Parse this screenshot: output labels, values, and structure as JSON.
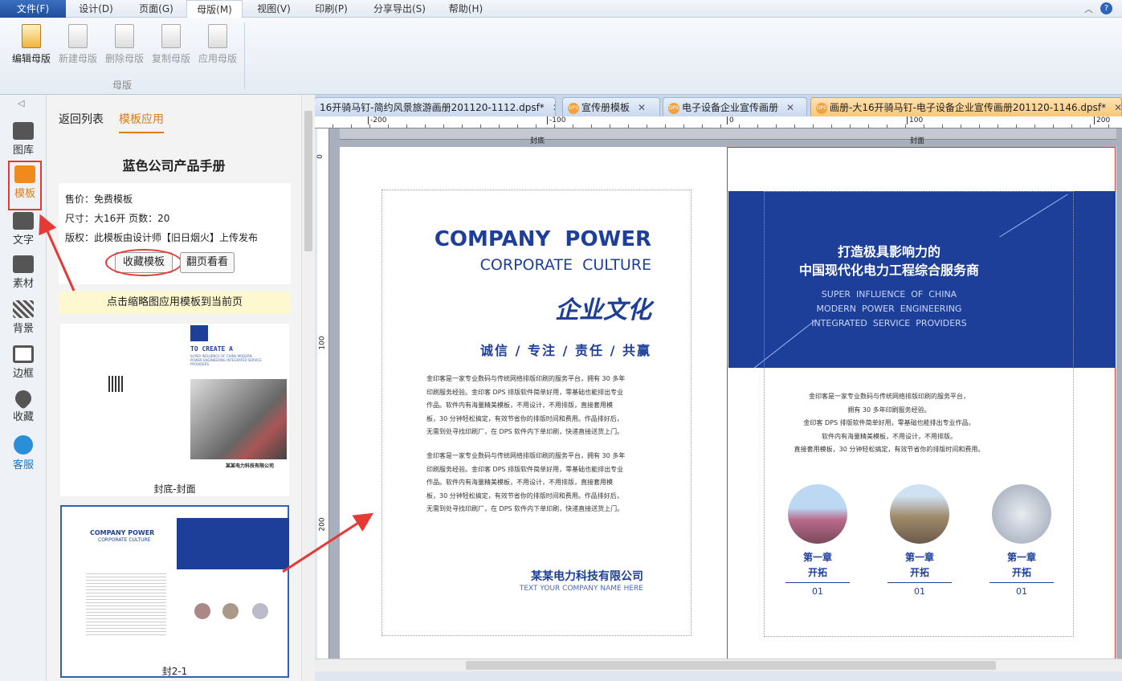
{
  "menu": {
    "items": [
      "文件(F)",
      "设计(D)",
      "页面(G)",
      "母版(M)",
      "视图(V)",
      "印刷(P)",
      "分享导出(S)",
      "帮助(H)"
    ]
  },
  "ribbon": {
    "buttons": [
      "编辑母版",
      "新建母版",
      "删除母版",
      "复制母版",
      "应用母版"
    ],
    "group": "母版"
  },
  "sidebar": {
    "items": [
      "图库",
      "模板",
      "文字",
      "素材",
      "背景",
      "边框",
      "收藏",
      "客服"
    ]
  },
  "panel": {
    "back": "返回列表",
    "tab_active": "模板应用",
    "title": "蓝色公司产品手册",
    "price": "售价：免费模板",
    "size": "尺寸：大16开 页数：20",
    "copyright": "版权：此模板由设计师【旧日烟火】上传发布",
    "fav_button": "收藏模板",
    "flip_button": "翻页看看",
    "hint": "点击缩略图应用模板到当前页",
    "thumbs": [
      {
        "label": "封底-封面",
        "cover_title": "TO CREATE A",
        "cover_sub": "SUPER INFLUENCE OF CHINA MODERN POWER ENGINEERING INTEGRATED SERVICE PROVIDERS",
        "company": "某某电力科技有限公司"
      },
      {
        "label": "封2-1"
      }
    ]
  },
  "tabs": [
    {
      "label": "16开骑马钉-简约风景旅游画册201120-1112.dpsf*"
    },
    {
      "label": "宣传册模板"
    },
    {
      "label": "电子设备企业宣传画册"
    },
    {
      "label": "画册-大16开骑马钉-电子设备企业宣传画册201120-1146.dpsf*",
      "active": true
    }
  ],
  "ruler": {
    "h": [
      "-200",
      "-100",
      "0",
      "100",
      "200"
    ],
    "v": [
      "0",
      "100",
      "200"
    ]
  },
  "pages": {
    "left_label": "封底",
    "right_label": "封面"
  },
  "left_page": {
    "title1": "COMPANY  POWER",
    "title2": "CORPORATE  CULTURE",
    "calligraphy": "企业文化",
    "values": "诚信 / 专注 / 责任 / 共赢",
    "para": [
      "金印客是一家专业数码与传统网络排版印刷的服务平台，拥有 30 多年",
      "印刷服务经验。金印客 DPS 排版软件简单好用，零基础也能排出专业",
      "作品。软件内有海量精美模板，不用设计，不用排版，直接套用模",
      "板，30 分钟轻松搞定，有效节省你的排版时间和费用。作品排好后，",
      "无需到处寻找印刷厂，在 DPS 软件内下单印刷，快递直接送货上门。"
    ],
    "company": "某某电力科技有限公司",
    "company_en": "TEXT YOUR COMPANY NAME HERE"
  },
  "right_page": {
    "head1": "打造极具影响力的",
    "head2": "中国现代化电力工程综合服务商",
    "en": [
      "SUPER  INFLUENCE  OF  CHINA",
      "MODERN  POWER  ENGINEERING",
      "INTEGRATED  SERVICE  PROVIDERS"
    ],
    "para": [
      "金印客是一家专业数码与传统网络排版印刷的服务平台，",
      "拥有 30 多年印刷服务经验。",
      "金印客 DPS 排版软件简单好用，零基础也能排出专业作品。",
      "软件内有海量精美模板，不用设计，不用排版。",
      "直接套用模板，30 分钟轻松搞定，有效节省你的排版时间和费用。"
    ],
    "chapters": [
      {
        "t": "第一章",
        "s": "开拓",
        "n": "01"
      },
      {
        "t": "第一章",
        "s": "开拓",
        "n": "01"
      },
      {
        "t": "第一章",
        "s": "开拓",
        "n": "01"
      }
    ]
  },
  "colors": {
    "brand_blue": "#1d3f9a",
    "annotation_red": "#e53935"
  }
}
